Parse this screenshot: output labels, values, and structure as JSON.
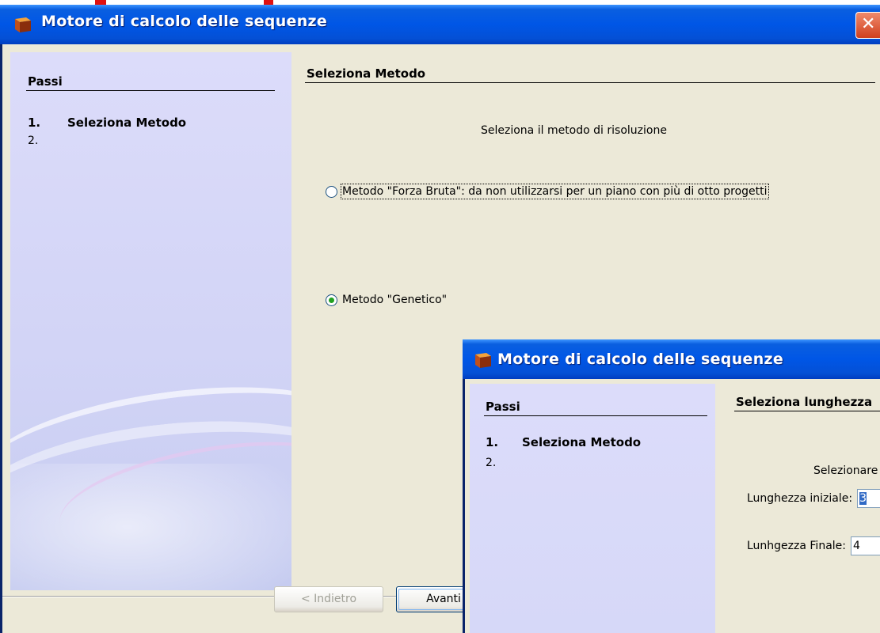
{
  "colors": {
    "title_bar": "#0056e6",
    "client_bg": "#ece9d8",
    "steps_panel": "#d2d4f6",
    "radio_checked": "#21a121",
    "close_button": "#d0401e"
  },
  "main_window": {
    "title": "Motore di calcolo delle sequenze",
    "close_icon": "close-icon",
    "steps": {
      "heading": "Passi",
      "items": [
        {
          "num": "1.",
          "label": "Seleziona Metodo"
        },
        {
          "num": "2.",
          "label": ""
        }
      ]
    },
    "section_title": "Seleziona Metodo",
    "instruction": "Seleziona il metodo di risoluzione",
    "options": [
      {
        "label": "Metodo \"Forza Bruta\": da non utilizzarsi per un piano con più di otto progetti",
        "checked": false
      },
      {
        "label": "Metodo \"Genetico\"",
        "checked": true
      }
    ],
    "buttons": {
      "back": "< Indietro",
      "next": "Avanti"
    }
  },
  "second_window": {
    "title": "Motore di calcolo delle sequenze",
    "steps": {
      "heading": "Passi",
      "items": [
        {
          "num": "1.",
          "label": "Seleziona Metodo"
        },
        {
          "num": "2.",
          "label": ""
        }
      ]
    },
    "section_title": "Seleziona lunghezza",
    "instruction": "Selezionare",
    "fields": [
      {
        "label": "Lunghezza iniziale:",
        "value": "3"
      },
      {
        "label": "Lunhgezza Finale:",
        "value": "4"
      }
    ]
  }
}
